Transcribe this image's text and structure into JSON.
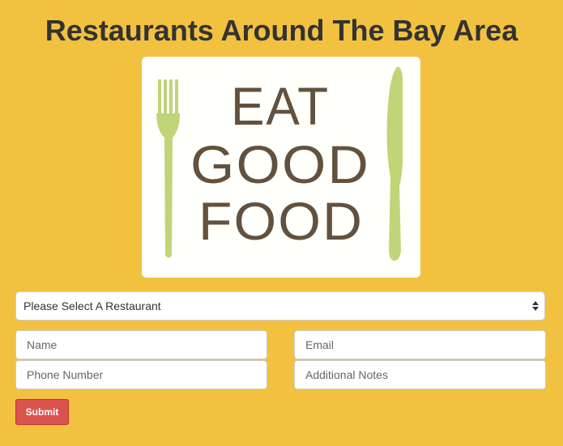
{
  "header": {
    "title": "Restaurants Around The Bay Area"
  },
  "logo": {
    "line1": "EAT",
    "line2": "GOOD",
    "line3": "FOOD",
    "text_color": "#62513e",
    "utensil_color": "#c0d478"
  },
  "form": {
    "restaurant_select": {
      "selected": "Please Select A Restaurant"
    },
    "name_placeholder": "Name",
    "email_placeholder": "Email",
    "phone_placeholder": "Phone Number",
    "notes_placeholder": "Additional Notes",
    "submit_label": "Submit"
  },
  "colors": {
    "background": "#f2c13f",
    "submit": "#d9534f"
  }
}
